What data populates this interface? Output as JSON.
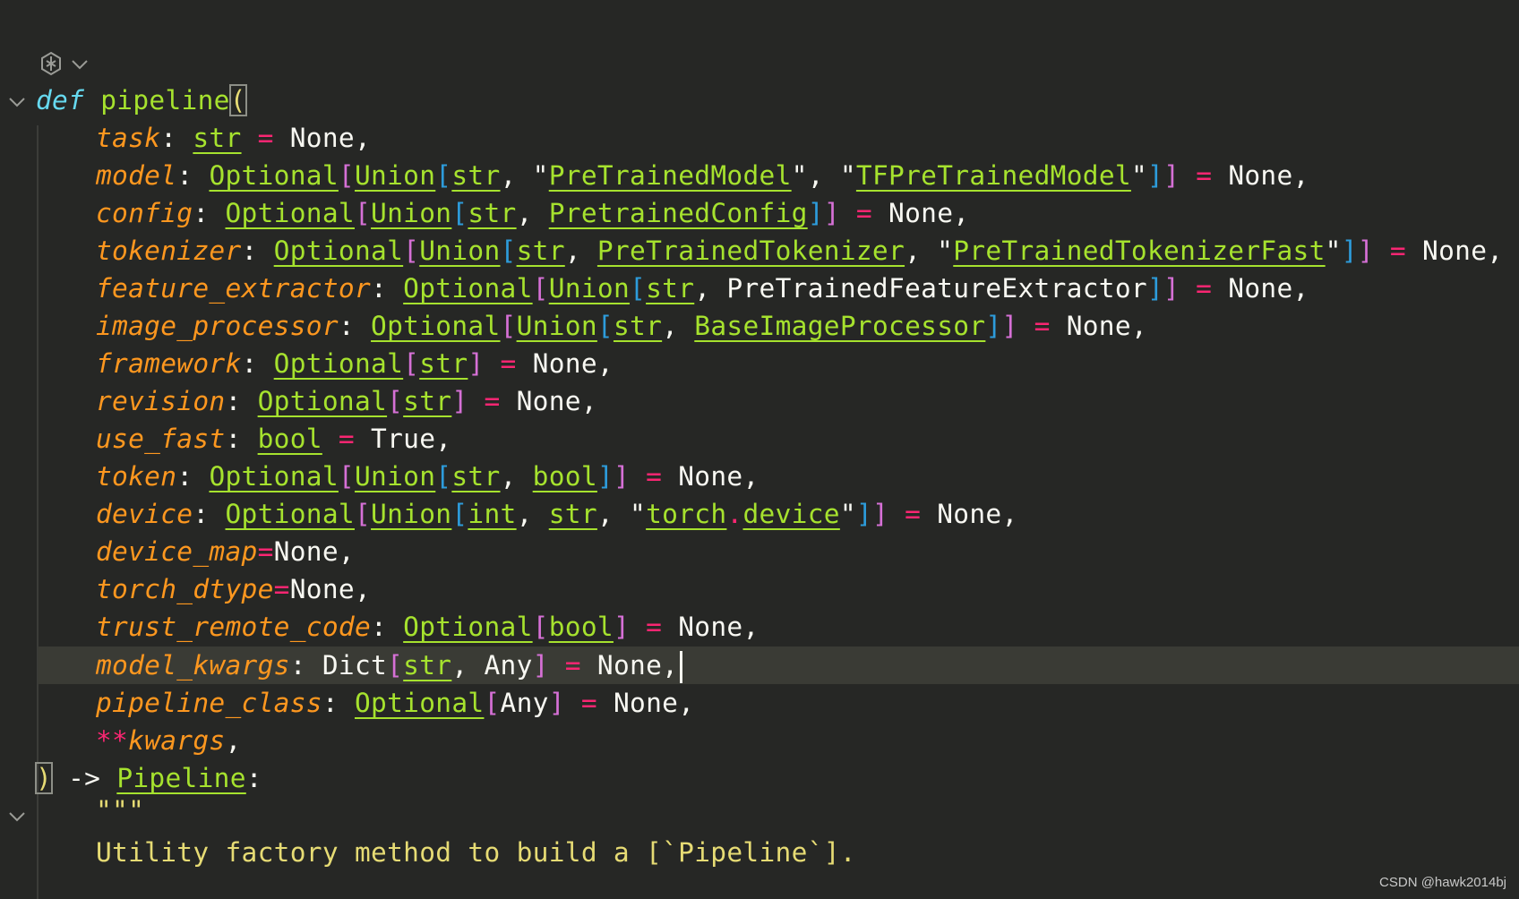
{
  "editor": {
    "function_keyword": "def",
    "function_name": "pipeline",
    "return_arrow": "->",
    "return_type": "Pipeline",
    "docstring_quotes": "\"\"\"",
    "docstring_text": "Utility factory method to build a [`Pipeline`].",
    "colors": {
      "background": "#262725",
      "keyword": "#66d9ef",
      "function": "#a6e22e",
      "parameter": "#fd971f",
      "operator": "#f92672",
      "docstring": "#e6db74"
    }
  },
  "params": [
    {
      "name": "task",
      "t": [
        "str"
      ],
      "default": "None"
    },
    {
      "name": "model",
      "default": "None"
    },
    {
      "name": "config",
      "default": "None"
    },
    {
      "name": "tokenizer",
      "default": "None"
    },
    {
      "name": "feature_extractor",
      "default": "None"
    },
    {
      "name": "image_processor",
      "default": "None"
    },
    {
      "name": "framework",
      "default": "None"
    },
    {
      "name": "revision",
      "default": "None"
    },
    {
      "name": "use_fast",
      "default": "True"
    },
    {
      "name": "token",
      "default": "None"
    },
    {
      "name": "device",
      "default": "None"
    },
    {
      "name": "device_map",
      "default": "None"
    },
    {
      "name": "torch_dtype",
      "default": "None"
    },
    {
      "name": "trust_remote_code",
      "default": "None"
    },
    {
      "name": "model_kwargs",
      "default": "None"
    },
    {
      "name": "pipeline_class",
      "default": "None"
    },
    {
      "name": "kwargs",
      "stars": "**"
    }
  ],
  "types": {
    "str": "str",
    "optional": "Optional",
    "union": "Union",
    "bool": "bool",
    "int": "int",
    "any": "Any",
    "dict": "Dict",
    "pretrained_model": "PreTrainedModel",
    "tf_pretrained_model": "TFPreTrainedModel",
    "pretrained_config": "PretrainedConfig",
    "pretrained_tokenizer": "PreTrainedTokenizer",
    "pretrained_tokenizer_fast": "PreTrainedTokenizerFast",
    "feature_extractor": "PreTrainedFeatureExtractor",
    "base_image_processor": "BaseImageProcessor",
    "torch": "torch",
    "device": "device"
  },
  "watermark": "CSDN @hawk2014bj"
}
